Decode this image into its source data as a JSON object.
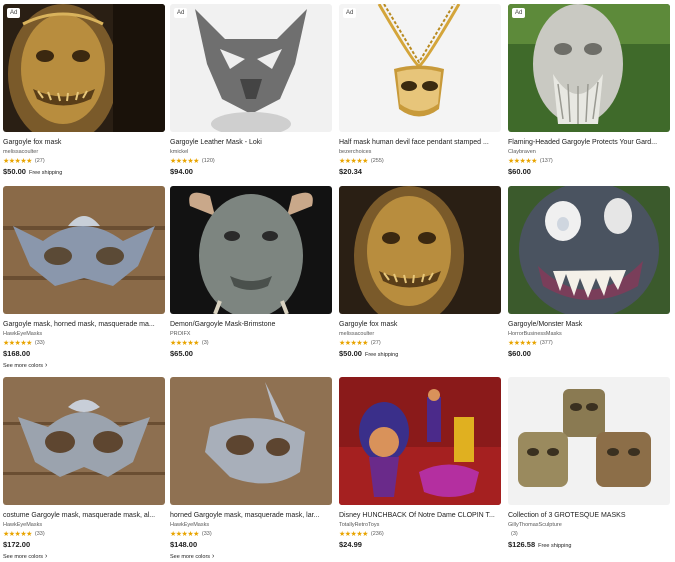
{
  "listings": [
    {
      "title": "Gargoyle fox mask",
      "seller": "melissacoulter",
      "stars": "★★★★★",
      "count": "(27)",
      "price": "$50.00",
      "shipping": "Free shipping",
      "ad": "Ad",
      "icon": "gold-gargoyle-mask-image"
    },
    {
      "title": "Gargoyle Leather Mask - Loki",
      "seller": "kmickel",
      "stars": "★★★★★",
      "count": "(120)",
      "price": "$94.00",
      "ad": "Ad",
      "icon": "grey-leather-mask-image"
    },
    {
      "title": "Half mask human devil face pendant stamped ...",
      "seller": "bezerchoices",
      "stars": "★★★★★",
      "count": "(255)",
      "price": "$20.34",
      "ad": "Ad",
      "icon": "gold-pendant-image"
    },
    {
      "title": "Flaming-Headed Gargoyle Protects Your Gard...",
      "seller": "Claybraven",
      "stars": "★★★★★",
      "count": "(137)",
      "price": "$60.00",
      "ad": "Ad",
      "icon": "stone-gargoyle-statue-image"
    },
    {
      "title": "Gargoyle mask, horned mask, masquerade ma...",
      "seller": "HawkEyeMasks",
      "stars": "★★★★★",
      "count": "(33)",
      "price": "$168.00",
      "colors": "See more colors",
      "icon": "horned-blue-mask-image"
    },
    {
      "title": "Demon/Gargoyle Mask-Brimstone",
      "seller": "PROIFX",
      "stars": "★★★★★",
      "count": "(3)",
      "price": "$65.00",
      "icon": "demon-latex-mask-image"
    },
    {
      "title": "Gargoyle fox mask",
      "seller": "melissacoulter",
      "stars": "★★★★★",
      "count": "(27)",
      "price": "$50.00",
      "shipping": "Free shipping",
      "icon": "gold-gargoyle-mask-image"
    },
    {
      "title": "Gargoyle/Monster Mask",
      "seller": "HorrorBusinessMasks",
      "stars": "★★★★★",
      "count": "(377)",
      "price": "$60.00",
      "icon": "monster-mask-image"
    },
    {
      "title": "costume Gargoyle mask, masquerade mask, al...",
      "seller": "HawkEyeMasks",
      "stars": "★★★★★",
      "count": "(33)",
      "price": "$172.00",
      "colors": "See more colors",
      "icon": "grey-eared-mask-image"
    },
    {
      "title": "horned Gargoyle mask, masquerade mask, lar...",
      "seller": "HawkEyeMasks",
      "stars": "★★★★★",
      "count": "(33)",
      "price": "$148.00",
      "colors": "See more colors",
      "icon": "horned-grey-mask-image"
    },
    {
      "title": "Disney HUNCHBACK Of Notre Dame CLOPIN T...",
      "seller": "TotallyRetroToys",
      "stars": "★★★★★",
      "count": "(236)",
      "price": "$24.99",
      "icon": "clopin-toy-set-image"
    },
    {
      "title": "Collection of 3 GROTESQUE MASKS",
      "seller": "GillyThomasSculpture",
      "stars": "",
      "count": "(3)",
      "price": "$126.58",
      "shipping": "Free shipping",
      "icon": "three-grotesque-masks-image"
    }
  ]
}
